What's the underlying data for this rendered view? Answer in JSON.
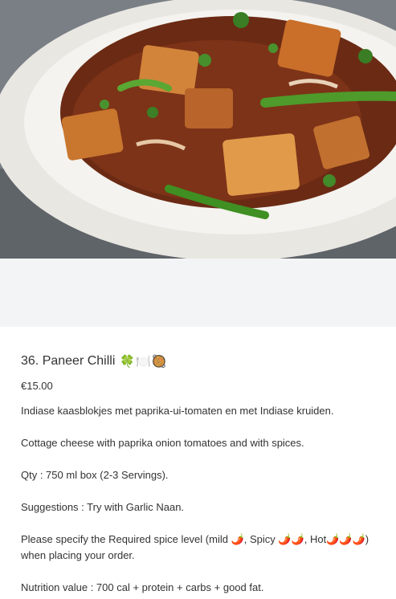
{
  "product": {
    "image_alt": "Paneer Chilli dish in a white bowl",
    "title": "36. Paneer Chilli",
    "title_emojis": "🍀🍽️🥘",
    "price": "€15.00",
    "description_nl": "Indiase kaasblokjes met paprika-ui-tomaten en met Indiase kruiden.",
    "description_en": "Cottage cheese with paprika onion tomatoes and with spices.",
    "quantity": "Qty : 750 ml box (2-3 Servings).",
    "suggestions": "Suggestions : Try with Garlic Naan.",
    "spice_prefix": "Please specify the Required spice level (mild ",
    "spice_mild": "🌶️",
    "spice_spicy_label": ", Spicy ",
    "spice_spicy": "🌶️🌶️",
    "spice_hot_label": ", Hot",
    "spice_hot": "🌶️🌶️🌶️",
    "spice_suffix": ") when placing your order.",
    "nutrition": "Nutrition value : 700 cal + protein + carbs + good fat."
  },
  "colors": {
    "text": "#333333",
    "gray_band": "#f3f4f5",
    "bowl": "#eceae4"
  }
}
